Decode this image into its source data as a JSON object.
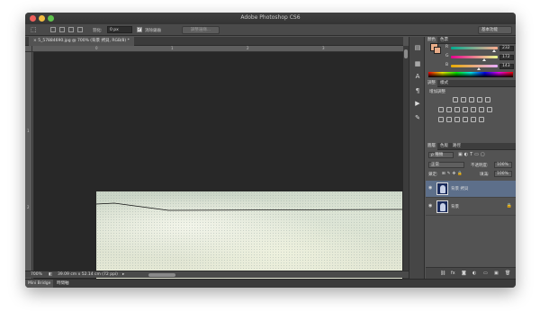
{
  "app": {
    "title": "Adobe Photoshop CS6"
  },
  "options_bar": {
    "tool_icon": "move-selection-icon",
    "feather_label": "羽化:",
    "feather_value": "0 px",
    "antialias_label": "消除鋸齒",
    "antialias_checked": true,
    "refine_edge_label": "調整邊緣...",
    "workspace_label": "基本功能"
  },
  "document_tab": {
    "label": "5_57884690.jpg @ 700% (背景 拷貝, RGB/8) *"
  },
  "rulers": {
    "h_ticks": [
      "0",
      "1",
      "2",
      "3"
    ],
    "v_ticks": [
      "1",
      "2"
    ]
  },
  "status": {
    "zoom": "700%",
    "doc_size": "39.09 cm x 52.14 cm (72 ppi)"
  },
  "bottom_tabs": [
    "Mini Bridge",
    "時間軸"
  ],
  "color_panel": {
    "tabs": [
      "顏色",
      "色票"
    ],
    "fg_color": "#e8ac88",
    "channels": [
      {
        "label": "R",
        "value": "232"
      },
      {
        "label": "G",
        "value": "172"
      },
      {
        "label": "B",
        "value": "143"
      }
    ]
  },
  "adjustments_panel": {
    "tabs": [
      "調整",
      "樣式"
    ],
    "heading": "增加調整"
  },
  "layers_panel": {
    "tabs": [
      "圖層",
      "色版",
      "路徑"
    ],
    "kind_filter": "ρ 種類",
    "blend_mode": "正常",
    "opacity_label": "不透明度:",
    "opacity_value": "100%",
    "lock_label": "鎖定:",
    "fill_label": "填滿:",
    "fill_value": "100%",
    "layers": [
      {
        "name": "背景 拷貝",
        "selected": true,
        "locked": false
      },
      {
        "name": "背景",
        "selected": false,
        "locked": true
      }
    ]
  },
  "colors": {
    "window_bg": "#535353",
    "canvas_bg": "#282828",
    "selection": "#5d6f8a"
  }
}
